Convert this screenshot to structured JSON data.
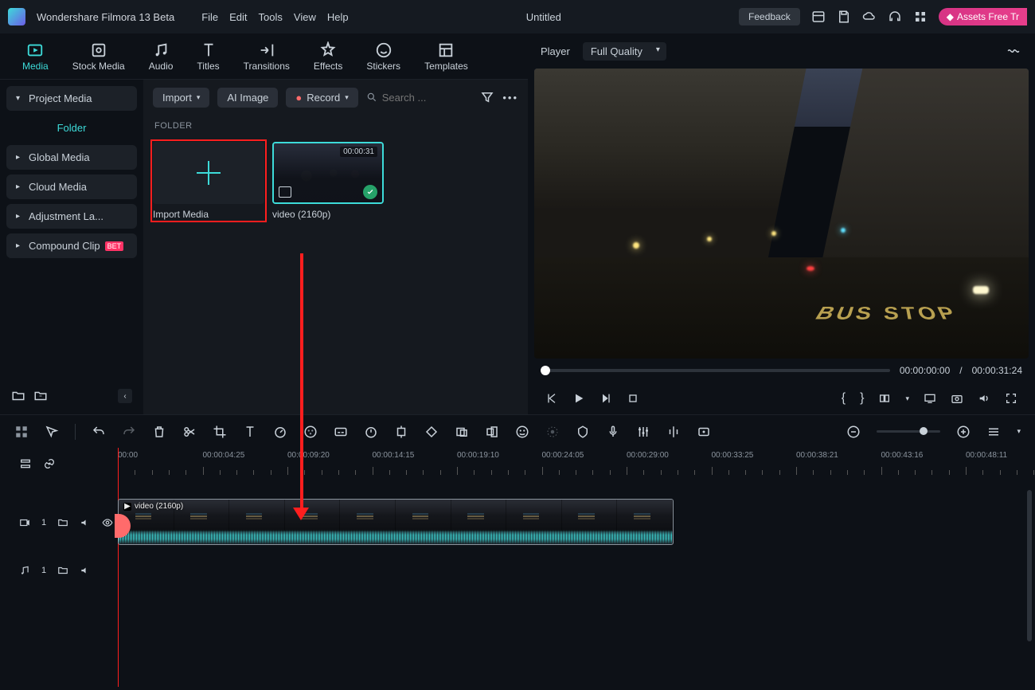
{
  "app": {
    "title": "Wondershare Filmora 13 Beta",
    "project": "Untitled"
  },
  "menu": [
    "File",
    "Edit",
    "Tools",
    "View",
    "Help"
  ],
  "titlebar": {
    "feedback": "Feedback",
    "assets": "Assets Free Tr"
  },
  "tabs": [
    {
      "label": "Media",
      "active": true
    },
    {
      "label": "Stock Media"
    },
    {
      "label": "Audio"
    },
    {
      "label": "Titles"
    },
    {
      "label": "Transitions"
    },
    {
      "label": "Effects"
    },
    {
      "label": "Stickers"
    },
    {
      "label": "Templates"
    }
  ],
  "sidebar": {
    "project": "Project Media",
    "folder": "Folder",
    "items": [
      "Global Media",
      "Cloud Media",
      "Adjustment La...",
      "Compound Clip"
    ]
  },
  "media_toolbar": {
    "import": "Import",
    "ai": "AI Image",
    "record": "Record",
    "search_placeholder": "Search ..."
  },
  "folder_header": "FOLDER",
  "thumbs": {
    "import_media": "Import Media",
    "video": {
      "name": "video (2160p)",
      "duration": "00:00:31"
    }
  },
  "preview": {
    "player_label": "Player",
    "quality": "Full Quality",
    "current": "00:00:00:00",
    "sep": "/",
    "total": "00:00:31:24",
    "road_text": "BUS\nSTOP"
  },
  "ruler_labels": [
    "00:00",
    "00:00:04:25",
    "00:00:09:20",
    "00:00:14:15",
    "00:00:19:10",
    "00:00:24:05",
    "00:00:29:00",
    "00:00:33:25",
    "00:00:38:21",
    "00:00:43:16",
    "00:00:48:11"
  ],
  "tracks": {
    "video": {
      "n": "1"
    },
    "audio": {
      "n": "1"
    },
    "clip_label": "video (2160p)"
  }
}
